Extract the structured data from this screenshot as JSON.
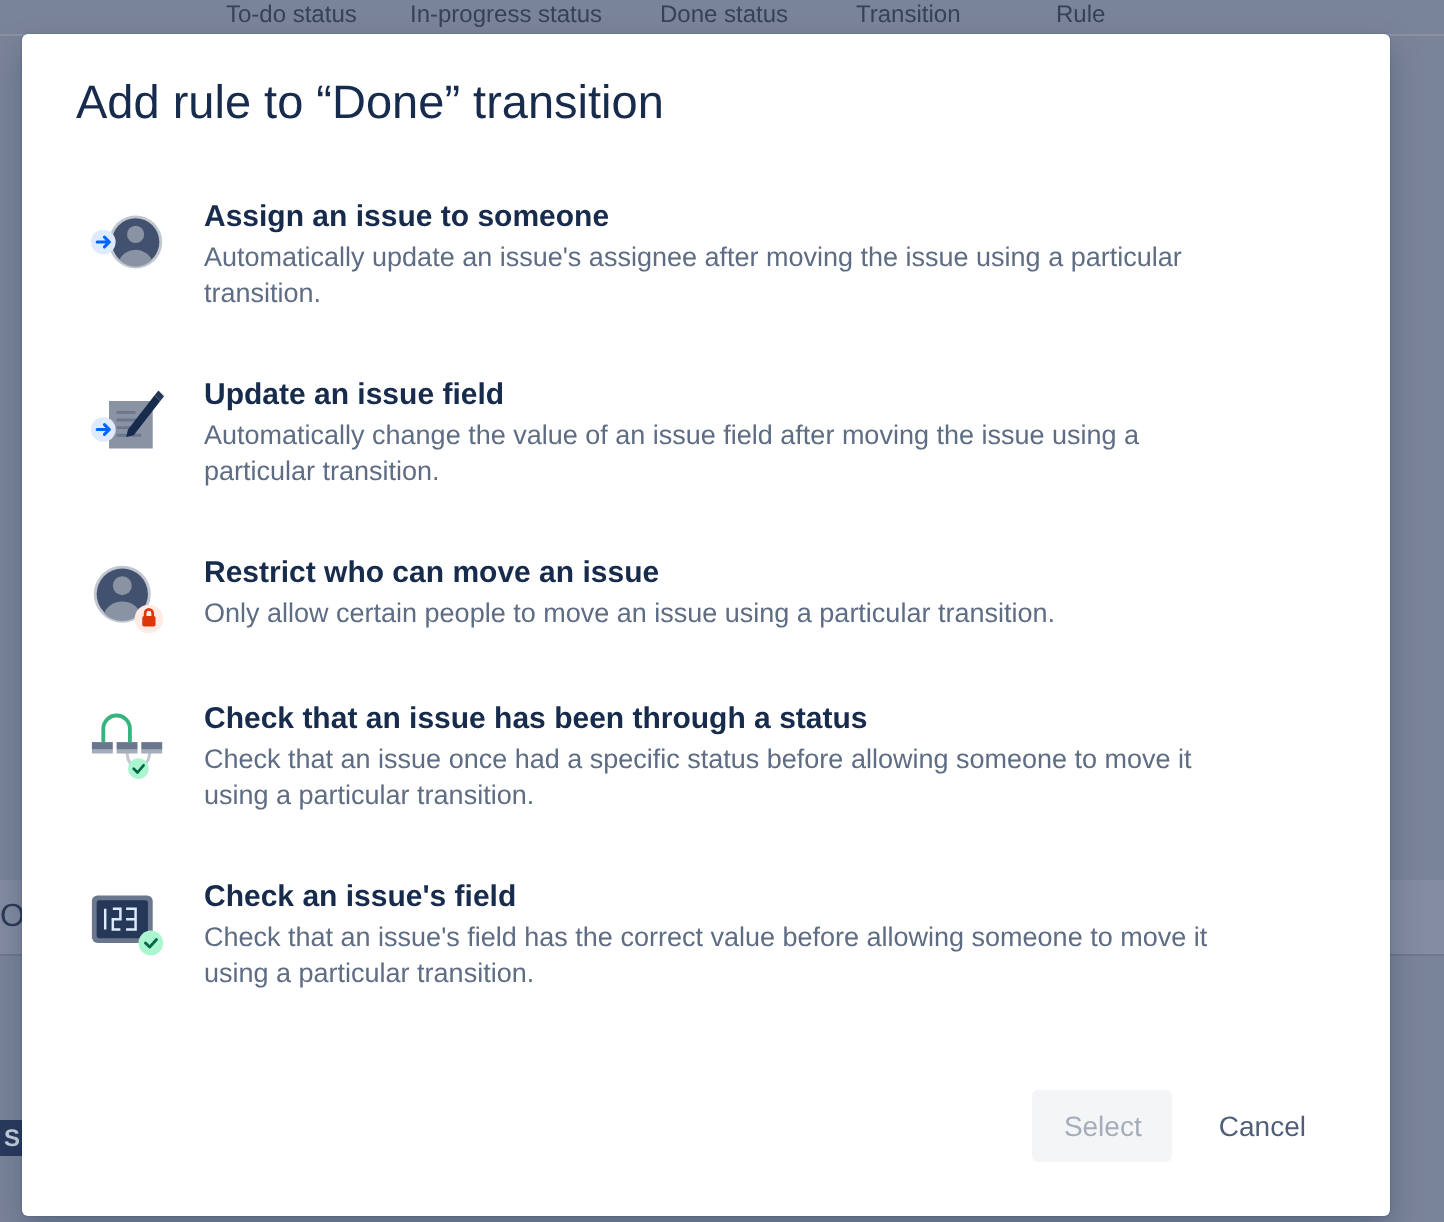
{
  "background": {
    "columns": [
      "To-do status",
      "In-progress status",
      "Done status",
      "Transition",
      "Rule"
    ],
    "cell_text": "O",
    "tag": "S"
  },
  "dialog": {
    "title": "Add rule to “Done” transition",
    "options": [
      {
        "title": "Assign an issue to someone",
        "description": "Automatically update an issue's assignee after moving the issue using a particular transition.",
        "selected": false
      },
      {
        "title": "Update an issue field",
        "description": "Automatically change the value of an issue field after moving the issue using a particular transition.",
        "selected": false
      },
      {
        "title": "Restrict who can move an issue",
        "description": "Only allow certain people to move an issue using a particular transition.",
        "selected": false
      },
      {
        "title": "Check that an issue has been through a status",
        "description": "Check that an issue once had a specific status before allowing someone to move it using a particular transition.",
        "selected": false
      },
      {
        "title": "Check an issue's field",
        "description": "Check that an issue's field has the correct value before allowing someone to move it using a particular transition.",
        "selected": false
      }
    ]
  },
  "buttons": [
    {
      "label": "Select",
      "kind": "primary",
      "disabled": true
    },
    {
      "label": "Cancel",
      "kind": "subtle",
      "disabled": false
    }
  ]
}
